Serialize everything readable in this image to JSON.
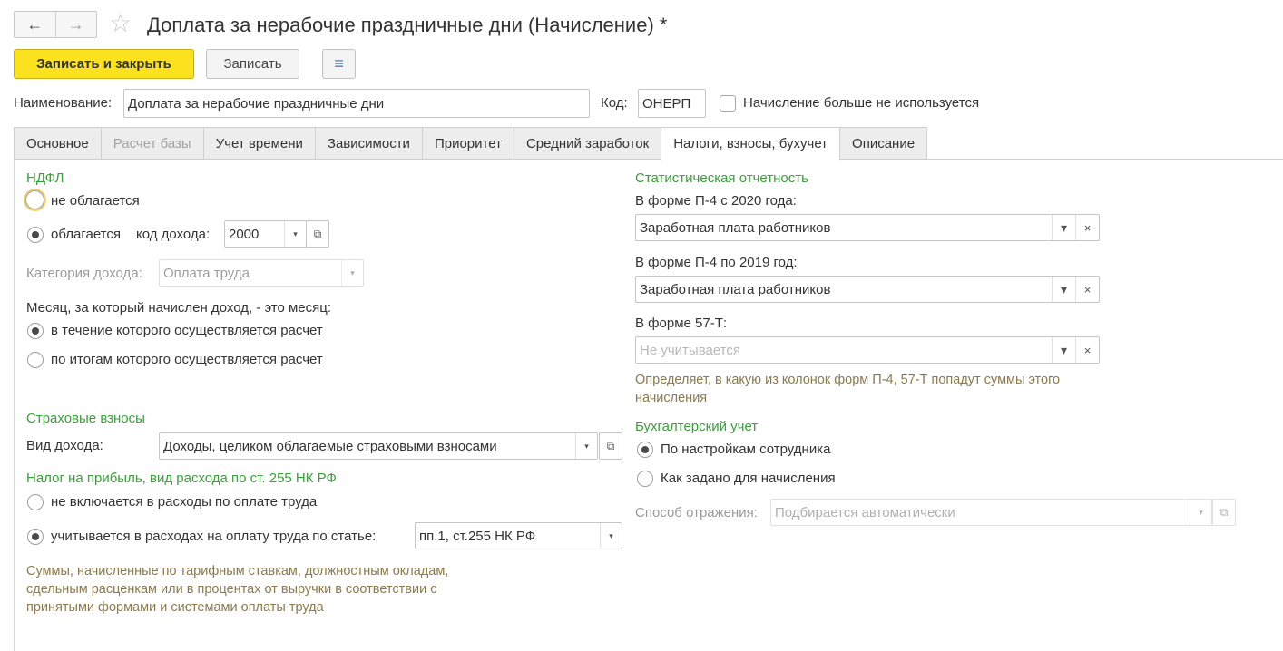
{
  "window": {
    "title": "Доплата за нерабочие праздничные дни (Начисление) *",
    "back_icon": "←",
    "forward_icon": "→",
    "favorite_icon": "☆"
  },
  "toolbar": {
    "save_close_label": "Записать и закрыть",
    "save_label": "Записать",
    "report_icon": "≡"
  },
  "header": {
    "name_label": "Наименование:",
    "name_value": "Доплата за нерабочие праздничные дни",
    "code_label": "Код:",
    "code_value": "ОНЕРП",
    "unused_label": "Начисление больше не используется"
  },
  "tabs": [
    {
      "label": "Основное"
    },
    {
      "label": "Расчет базы"
    },
    {
      "label": "Учет времени"
    },
    {
      "label": "Зависимости"
    },
    {
      "label": "Приоритет"
    },
    {
      "label": "Средний заработок"
    },
    {
      "label": "Налоги, взносы, бухучет"
    },
    {
      "label": "Описание"
    }
  ],
  "ndfl": {
    "section_title": "НДФЛ",
    "not_taxed_label": "не облагается",
    "taxed_label": "облагается",
    "income_code_label": "код дохода:",
    "income_code_value": "2000",
    "category_label": "Категория дохода:",
    "category_value": "Оплата труда",
    "month_label": "Месяц, за который начислен доход, - это месяц:",
    "month_option_1": "в течение которого осуществляется расчет",
    "month_option_2": "по итогам которого осуществляется расчет"
  },
  "insurance": {
    "section_title": "Страховые взносы",
    "income_type_label": "Вид дохода:",
    "income_type_value": "Доходы, целиком облагаемые страховыми взносами"
  },
  "profit_tax": {
    "section_title": "Налог на прибыль, вид расхода по ст. 255 НК РФ",
    "option_1": "не включается в расходы по оплате труда",
    "option_2": "учитывается в расходах на оплату труда по статье:",
    "article_value": "пп.1, ст.255 НК РФ",
    "hint": "Суммы, начисленные по тарифным ставкам, должностным окладам, сдельным расценкам или в процентах от выручки в соответствии с принятыми формами и системами оплаты труда"
  },
  "statistics": {
    "section_title": "Статистическая отчетность",
    "p4_2020_label": "В форме П-4 с 2020 года:",
    "p4_2020_value": "Заработная плата работников",
    "p4_2019_label": "В форме П-4 по 2019 год:",
    "p4_2019_value": "Заработная плата работников",
    "f57t_label": "В форме 57-Т:",
    "f57t_placeholder": "Не учитывается",
    "hint": "Определяет, в какую из колонок форм П-4, 57-Т попадут суммы этого начисления"
  },
  "accounting": {
    "section_title": "Бухгалтерский учет",
    "option_1": "По настройкам сотрудника",
    "option_2": "Как задано для начисления",
    "method_label": "Способ отражения:",
    "method_placeholder": "Подбирается автоматически"
  },
  "icons": {
    "dropdown": "▾",
    "clear": "×",
    "open": "⧉"
  }
}
